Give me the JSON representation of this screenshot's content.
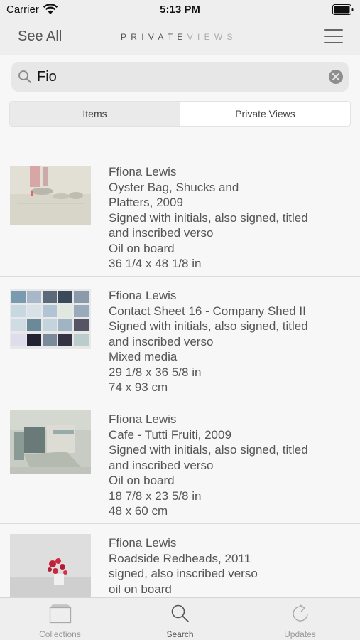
{
  "status_bar": {
    "carrier": "Carrier",
    "time": "5:13 PM"
  },
  "nav": {
    "back_label": "See All",
    "brand_part1": "PRIVATE",
    "brand_part2": "VIEWS"
  },
  "search": {
    "value": "Fio",
    "placeholder": ""
  },
  "segments": [
    {
      "label": "Items",
      "selected": true
    },
    {
      "label": "Private Views",
      "selected": false
    }
  ],
  "results": [
    {
      "artist": "Ffiona Lewis",
      "title_lines": [
        "Oyster Bag, Shucks and",
        "Platters, 2009"
      ],
      "inscription_lines": [
        "Signed with initials, also signed, titled",
        "and inscribed verso"
      ],
      "medium": "Oil on board",
      "dimensions": [
        "36 1/4 x 48 1/8 in"
      ]
    },
    {
      "artist": "Ffiona Lewis",
      "title_lines": [
        "Contact Sheet 16 - Company Shed II"
      ],
      "inscription_lines": [
        "Signed with initials, also signed, titled",
        "and inscribed verso"
      ],
      "medium": "Mixed media",
      "dimensions": [
        "29 1/8 x 36 5/8 in",
        "74 x 93 cm"
      ]
    },
    {
      "artist": "Ffiona Lewis",
      "title_lines": [
        "Cafe - Tutti Fruiti, 2009"
      ],
      "inscription_lines": [
        "Signed with initials, also signed, titled",
        "and inscribed verso"
      ],
      "medium": "Oil on board",
      "dimensions": [
        "18 7/8 x 23 5/8 in",
        "48 x 60 cm"
      ]
    },
    {
      "artist": "Ffiona Lewis",
      "title_lines": [
        "Roadside Redheads, 2011"
      ],
      "inscription_lines": [
        "signed, also inscribed verso"
      ],
      "medium": "oil on board",
      "dimensions": []
    }
  ],
  "tabs": [
    {
      "label": "Collections",
      "icon": "collections-icon",
      "active": false
    },
    {
      "label": "Search",
      "icon": "search-icon",
      "active": true
    },
    {
      "label": "Updates",
      "icon": "refresh-icon",
      "active": false
    }
  ],
  "colors": {
    "bar_background": "#eeeeee",
    "page_background": "#f7f7f7",
    "text": "#555555",
    "accent_caret": "#1a73e8"
  }
}
